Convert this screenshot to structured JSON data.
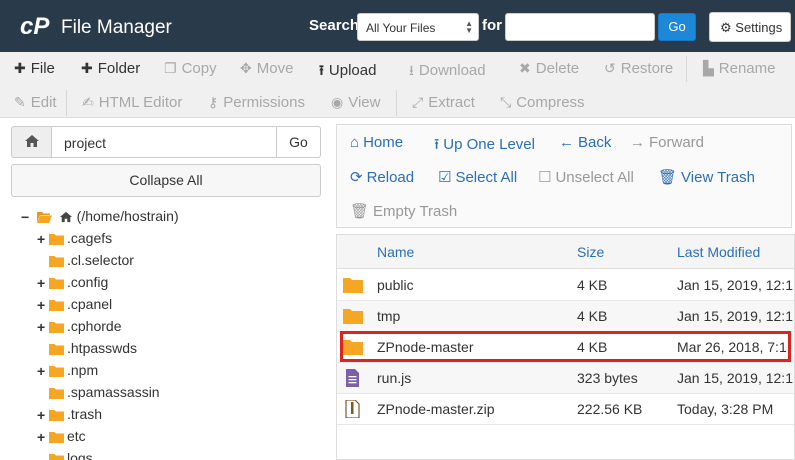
{
  "header": {
    "app_title": "File Manager",
    "search_label": "Search",
    "search_scope": "All Your Files",
    "for_label": "for",
    "search_value": "",
    "go_label": "Go",
    "settings_label": "Settings",
    "bg_color": "#293a4a",
    "accent_color": "#1e88d8"
  },
  "toolbar": {
    "row1": [
      {
        "label": "File",
        "icon": "plus-icon",
        "enabled": true
      },
      {
        "label": "Folder",
        "icon": "plus-icon",
        "enabled": true
      },
      {
        "label": "Copy",
        "icon": "copy-icon",
        "enabled": false
      },
      {
        "label": "Move",
        "icon": "move-icon",
        "enabled": false
      },
      {
        "label": "Upload",
        "icon": "upload-icon",
        "enabled": true
      },
      {
        "label": "Download",
        "icon": "download-icon",
        "enabled": false
      },
      {
        "label": "Delete",
        "icon": "delete-icon",
        "enabled": false
      },
      {
        "label": "Restore",
        "icon": "restore-icon",
        "enabled": false
      },
      {
        "label": "Rename",
        "icon": "rename-icon",
        "enabled": false
      }
    ],
    "row2": [
      {
        "label": "Edit",
        "icon": "pencil-icon",
        "enabled": false
      },
      {
        "label": "HTML Editor",
        "icon": "html-editor-icon",
        "enabled": false
      },
      {
        "label": "Permissions",
        "icon": "key-icon",
        "enabled": false
      },
      {
        "label": "View",
        "icon": "eye-icon",
        "enabled": false
      },
      {
        "label": "Extract",
        "icon": "extract-icon",
        "enabled": false
      },
      {
        "label": "Compress",
        "icon": "compress-icon",
        "enabled": false
      }
    ]
  },
  "left": {
    "path_value": "project",
    "go_label": "Go",
    "collapse_label": "Collapse All",
    "root_label": "(/home/hostrain)",
    "tree": [
      {
        "label": ".cagefs",
        "expandable": true
      },
      {
        "label": ".cl.selector",
        "expandable": false
      },
      {
        "label": ".config",
        "expandable": true
      },
      {
        "label": ".cpanel",
        "expandable": true
      },
      {
        "label": ".cphorde",
        "expandable": true
      },
      {
        "label": ".htpasswds",
        "expandable": false
      },
      {
        "label": ".npm",
        "expandable": true
      },
      {
        "label": ".spamassassin",
        "expandable": false
      },
      {
        "label": ".trash",
        "expandable": true
      },
      {
        "label": "etc",
        "expandable": true
      },
      {
        "label": "logs",
        "expandable": false
      }
    ]
  },
  "nav": {
    "home": "Home",
    "up_one_level": "Up One Level",
    "back": "Back",
    "forward": "Forward",
    "reload": "Reload",
    "select_all": "Select All",
    "unselect_all": "Unselect All",
    "view_trash": "View Trash",
    "empty_trash": "Empty Trash"
  },
  "files": {
    "columns": {
      "name": "Name",
      "size": "Size",
      "modified": "Last Modified"
    },
    "rows": [
      {
        "name": "public",
        "size": "4 KB",
        "modified": "Jan 15, 2019, 12:1",
        "type": "folder"
      },
      {
        "name": "tmp",
        "size": "4 KB",
        "modified": "Jan 15, 2019, 12:1",
        "type": "folder"
      },
      {
        "name": "ZPnode-master",
        "size": "4 KB",
        "modified": "Mar 26, 2018, 7:1",
        "type": "folder",
        "highlighted": true
      },
      {
        "name": "run.js",
        "size": "323 bytes",
        "modified": "Jan 15, 2019, 12:1",
        "type": "script"
      },
      {
        "name": "ZPnode-master.zip",
        "size": "222.56 KB",
        "modified": "Today, 3:28 PM",
        "type": "archive"
      }
    ],
    "highlight_color": "#d9251d",
    "folder_color": "#f5a623"
  }
}
